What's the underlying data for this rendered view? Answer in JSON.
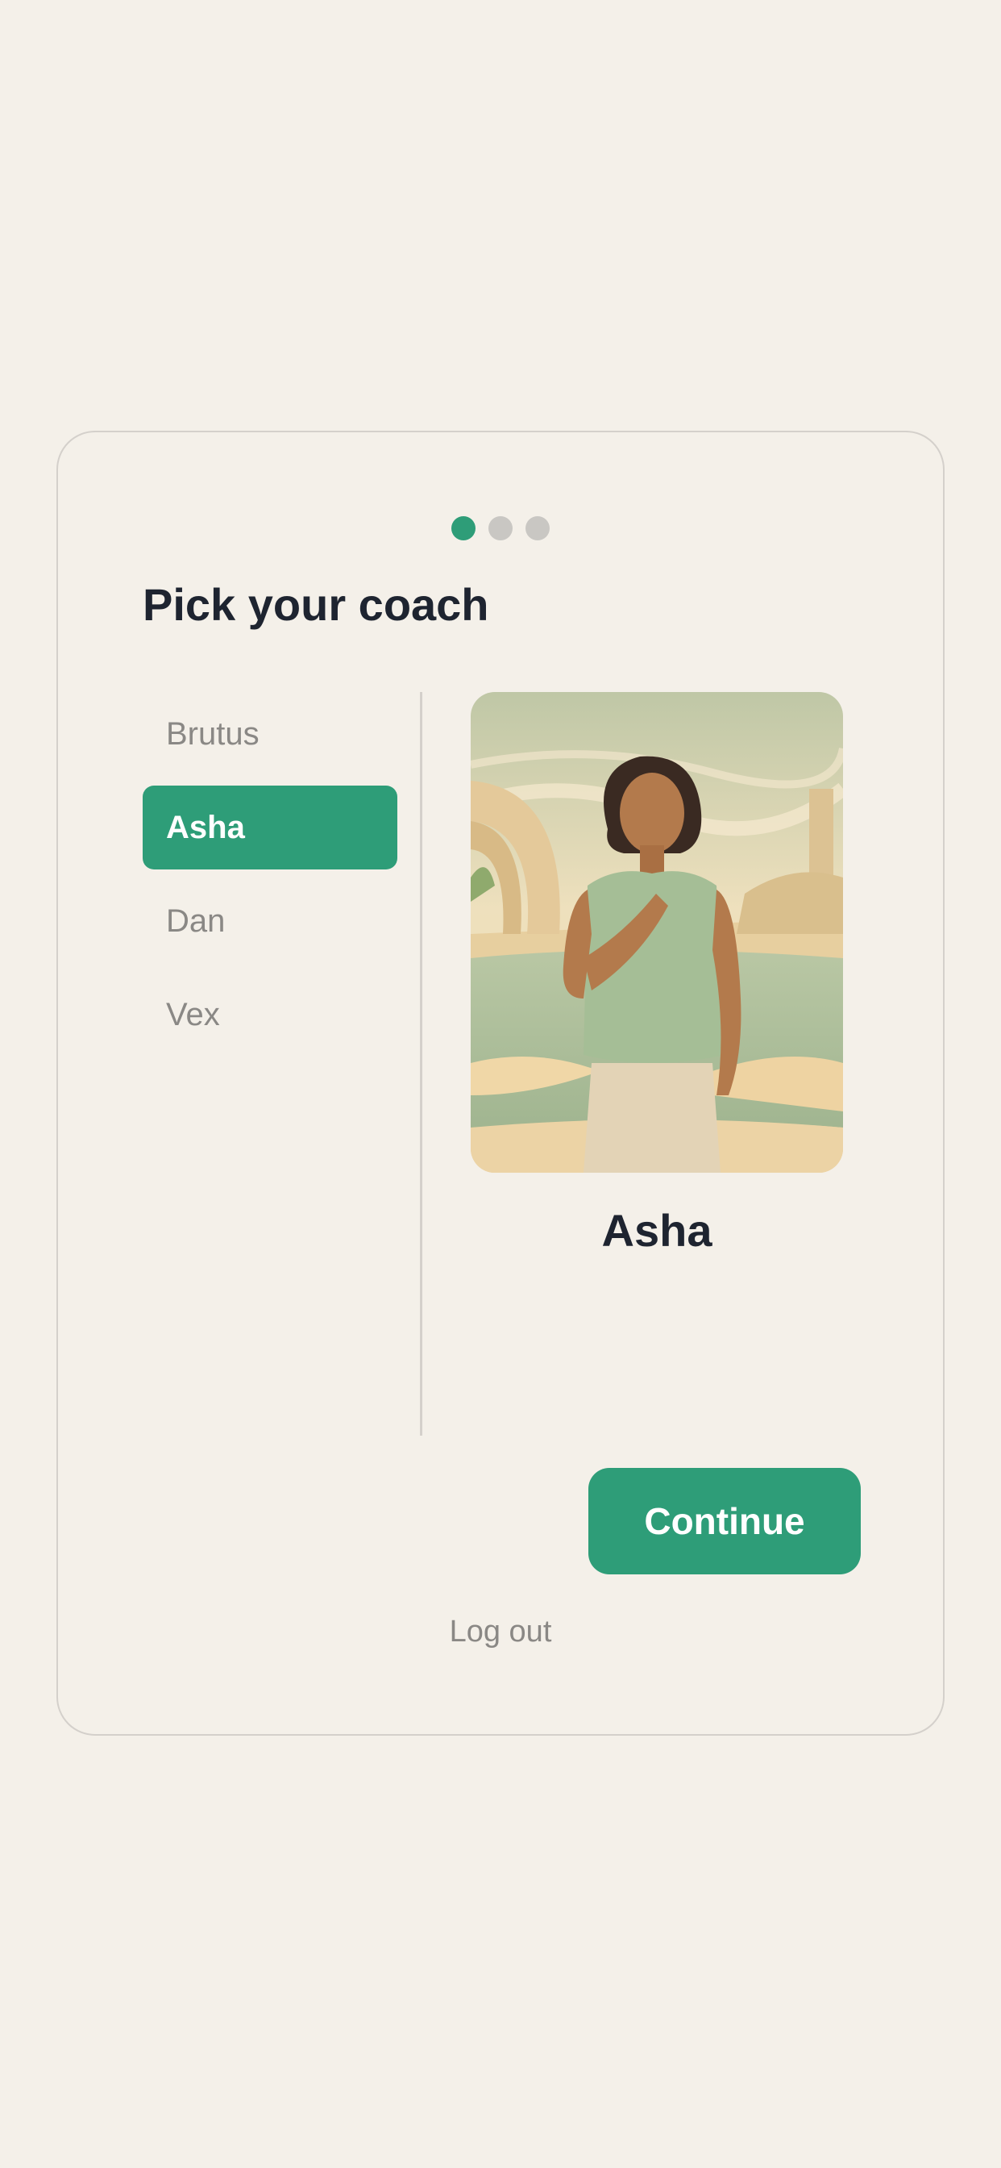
{
  "onboarding": {
    "step_indicator": [
      true,
      false,
      false
    ],
    "title": "Pick your coach",
    "coaches": [
      {
        "label": "Brutus",
        "selected": false
      },
      {
        "label": "Asha",
        "selected": true
      },
      {
        "label": "Dan",
        "selected": false
      },
      {
        "label": "Vex",
        "selected": false
      }
    ],
    "selected_coach": {
      "name": "Asha",
      "portrait": "illustrated-woman-portrait"
    },
    "continue_label": "Continue",
    "logout_label": "Log out"
  },
  "colors": {
    "accent": "#2e9d78",
    "background": "#f4f0e9",
    "text_dark": "#1e2430",
    "text_muted": "#8a8885",
    "dot_inactive": "#c9c7c3"
  }
}
